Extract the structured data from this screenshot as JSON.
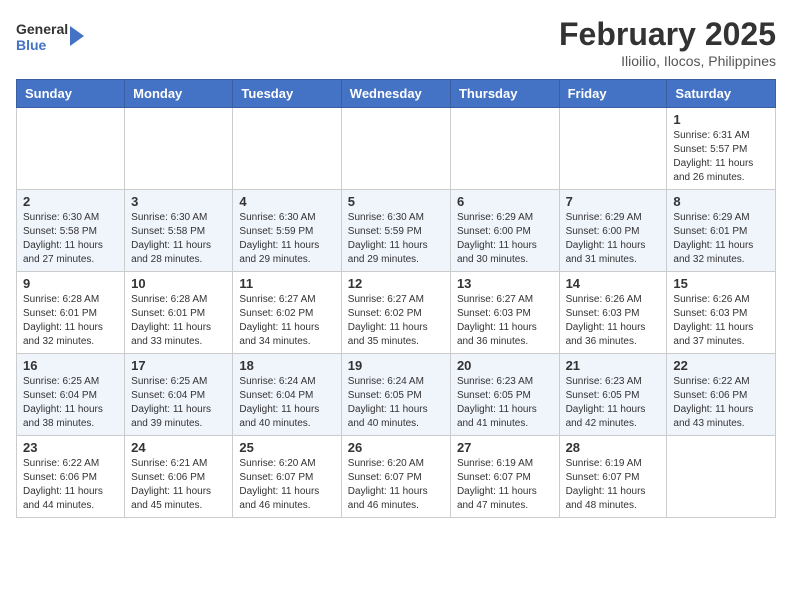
{
  "header": {
    "logo_line1": "General",
    "logo_line2": "Blue",
    "month_year": "February 2025",
    "location": "Ilioilio, Ilocos, Philippines"
  },
  "days_of_week": [
    "Sunday",
    "Monday",
    "Tuesday",
    "Wednesday",
    "Thursday",
    "Friday",
    "Saturday"
  ],
  "weeks": [
    [
      {
        "day": "",
        "info": ""
      },
      {
        "day": "",
        "info": ""
      },
      {
        "day": "",
        "info": ""
      },
      {
        "day": "",
        "info": ""
      },
      {
        "day": "",
        "info": ""
      },
      {
        "day": "",
        "info": ""
      },
      {
        "day": "1",
        "info": "Sunrise: 6:31 AM\nSunset: 5:57 PM\nDaylight: 11 hours\nand 26 minutes."
      }
    ],
    [
      {
        "day": "2",
        "info": "Sunrise: 6:30 AM\nSunset: 5:58 PM\nDaylight: 11 hours\nand 27 minutes."
      },
      {
        "day": "3",
        "info": "Sunrise: 6:30 AM\nSunset: 5:58 PM\nDaylight: 11 hours\nand 28 minutes."
      },
      {
        "day": "4",
        "info": "Sunrise: 6:30 AM\nSunset: 5:59 PM\nDaylight: 11 hours\nand 29 minutes."
      },
      {
        "day": "5",
        "info": "Sunrise: 6:30 AM\nSunset: 5:59 PM\nDaylight: 11 hours\nand 29 minutes."
      },
      {
        "day": "6",
        "info": "Sunrise: 6:29 AM\nSunset: 6:00 PM\nDaylight: 11 hours\nand 30 minutes."
      },
      {
        "day": "7",
        "info": "Sunrise: 6:29 AM\nSunset: 6:00 PM\nDaylight: 11 hours\nand 31 minutes."
      },
      {
        "day": "8",
        "info": "Sunrise: 6:29 AM\nSunset: 6:01 PM\nDaylight: 11 hours\nand 32 minutes."
      }
    ],
    [
      {
        "day": "9",
        "info": "Sunrise: 6:28 AM\nSunset: 6:01 PM\nDaylight: 11 hours\nand 32 minutes."
      },
      {
        "day": "10",
        "info": "Sunrise: 6:28 AM\nSunset: 6:01 PM\nDaylight: 11 hours\nand 33 minutes."
      },
      {
        "day": "11",
        "info": "Sunrise: 6:27 AM\nSunset: 6:02 PM\nDaylight: 11 hours\nand 34 minutes."
      },
      {
        "day": "12",
        "info": "Sunrise: 6:27 AM\nSunset: 6:02 PM\nDaylight: 11 hours\nand 35 minutes."
      },
      {
        "day": "13",
        "info": "Sunrise: 6:27 AM\nSunset: 6:03 PM\nDaylight: 11 hours\nand 36 minutes."
      },
      {
        "day": "14",
        "info": "Sunrise: 6:26 AM\nSunset: 6:03 PM\nDaylight: 11 hours\nand 36 minutes."
      },
      {
        "day": "15",
        "info": "Sunrise: 6:26 AM\nSunset: 6:03 PM\nDaylight: 11 hours\nand 37 minutes."
      }
    ],
    [
      {
        "day": "16",
        "info": "Sunrise: 6:25 AM\nSunset: 6:04 PM\nDaylight: 11 hours\nand 38 minutes."
      },
      {
        "day": "17",
        "info": "Sunrise: 6:25 AM\nSunset: 6:04 PM\nDaylight: 11 hours\nand 39 minutes."
      },
      {
        "day": "18",
        "info": "Sunrise: 6:24 AM\nSunset: 6:04 PM\nDaylight: 11 hours\nand 40 minutes."
      },
      {
        "day": "19",
        "info": "Sunrise: 6:24 AM\nSunset: 6:05 PM\nDaylight: 11 hours\nand 40 minutes."
      },
      {
        "day": "20",
        "info": "Sunrise: 6:23 AM\nSunset: 6:05 PM\nDaylight: 11 hours\nand 41 minutes."
      },
      {
        "day": "21",
        "info": "Sunrise: 6:23 AM\nSunset: 6:05 PM\nDaylight: 11 hours\nand 42 minutes."
      },
      {
        "day": "22",
        "info": "Sunrise: 6:22 AM\nSunset: 6:06 PM\nDaylight: 11 hours\nand 43 minutes."
      }
    ],
    [
      {
        "day": "23",
        "info": "Sunrise: 6:22 AM\nSunset: 6:06 PM\nDaylight: 11 hours\nand 44 minutes."
      },
      {
        "day": "24",
        "info": "Sunrise: 6:21 AM\nSunset: 6:06 PM\nDaylight: 11 hours\nand 45 minutes."
      },
      {
        "day": "25",
        "info": "Sunrise: 6:20 AM\nSunset: 6:07 PM\nDaylight: 11 hours\nand 46 minutes."
      },
      {
        "day": "26",
        "info": "Sunrise: 6:20 AM\nSunset: 6:07 PM\nDaylight: 11 hours\nand 46 minutes."
      },
      {
        "day": "27",
        "info": "Sunrise: 6:19 AM\nSunset: 6:07 PM\nDaylight: 11 hours\nand 47 minutes."
      },
      {
        "day": "28",
        "info": "Sunrise: 6:19 AM\nSunset: 6:07 PM\nDaylight: 11 hours\nand 48 minutes."
      },
      {
        "day": "",
        "info": ""
      }
    ]
  ]
}
